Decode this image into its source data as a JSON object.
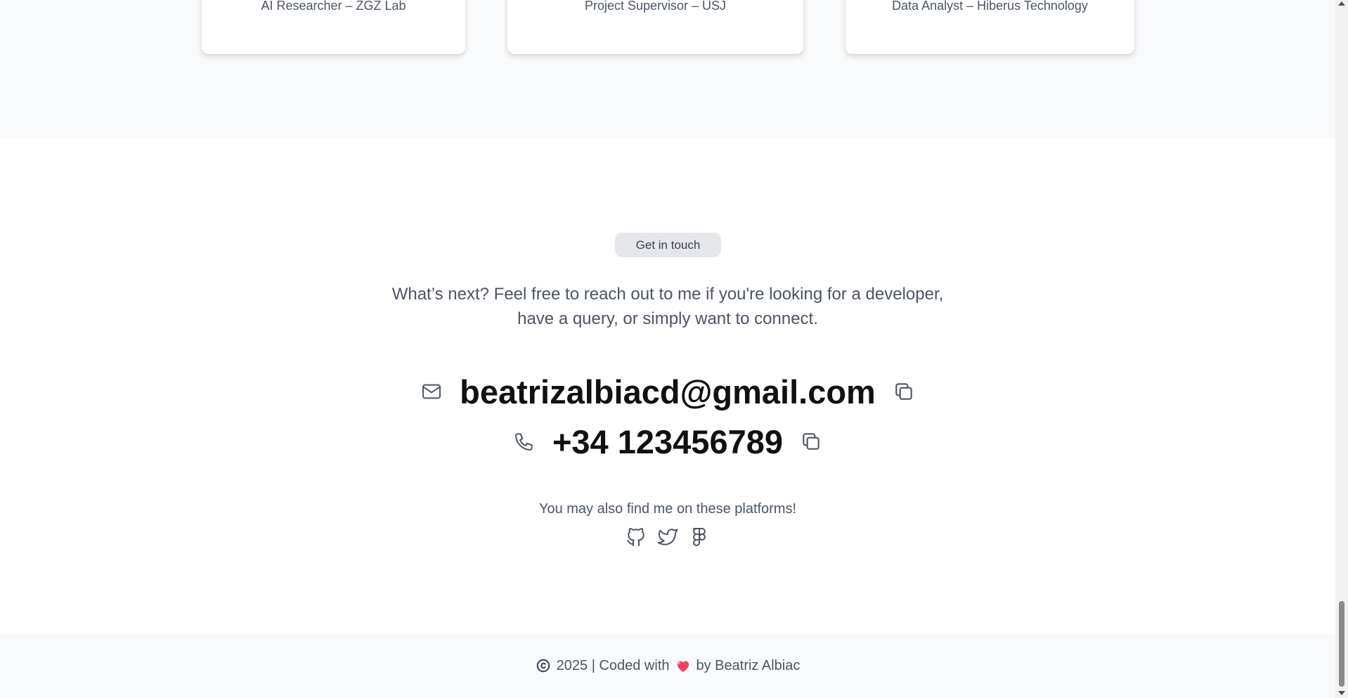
{
  "experience": {
    "cards": [
      {
        "label": "AI Researcher – ZGZ Lab"
      },
      {
        "label": "Project Supervisor – USJ"
      },
      {
        "label": "Data Analyst – Hiberus Technology"
      }
    ]
  },
  "contact": {
    "badge": "Get in touch",
    "intro": "What’s next? Feel free to reach out to me if you're looking for a developer, have a query, or simply want to connect.",
    "email": "beatrizalbiacd@gmail.com",
    "phone": "+34 123456789",
    "platforms_text": "You may also find me on these platforms!",
    "socials": [
      "github-icon",
      "twitter-icon",
      "figma-icon"
    ]
  },
  "footer": {
    "year_text": "2025 | Coded with",
    "by_text": "by Beatriz Albiac"
  },
  "colors": {
    "section_bg": "#f9fafb",
    "badge_bg": "#e5e7eb",
    "text": "#4b5563",
    "heading": "#111111",
    "heart": "#e11d48"
  }
}
